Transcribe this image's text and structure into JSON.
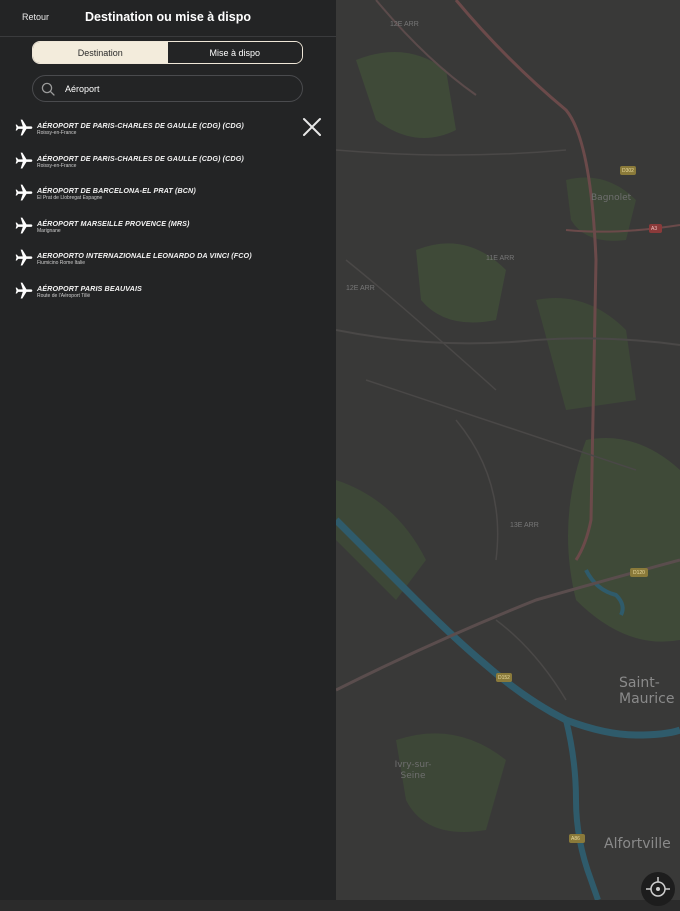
{
  "header": {
    "back_label": "Retour",
    "title": "Destination ou mise à dispo"
  },
  "segmented": {
    "tabs": [
      {
        "label": "Destination",
        "active": true
      },
      {
        "label": "Mise à dispo",
        "active": false
      }
    ]
  },
  "search": {
    "value": "Aéroport",
    "icon": "search-icon"
  },
  "results": [
    {
      "title": "AÉROPORT DE PARIS-CHARLES DE GAULLE (CDG) (CDG)",
      "subtitle": "Roissy-en-France",
      "icon": "airplane-icon"
    },
    {
      "title": "AÉROPORT DE PARIS-CHARLES DE GAULLE (CDG) (CDG)",
      "subtitle": "Roissy-en-France",
      "icon": "airplane-icon"
    },
    {
      "title": "AÉROPORT DE BARCELONA-EL PRAT (BCN)",
      "subtitle": "El Prat de Llobregat Espagne",
      "icon": "airplane-icon"
    },
    {
      "title": "AÉROPORT MARSEILLE PROVENCE (MRS)",
      "subtitle": "Marignane",
      "icon": "airplane-icon"
    },
    {
      "title": "AEROPORTO INTERNAZIONALE LEONARDO DA VINCI (FCO)",
      "subtitle": "Fiumicino Rome Italie",
      "icon": "airplane-icon"
    },
    {
      "title": "AÉROPORT PARIS BEAUVAIS",
      "subtitle": "Route de l'Aéroport Tillé",
      "icon": "airplane-icon"
    }
  ],
  "close_icon": "close-icon",
  "map": {
    "labels": [
      "12E ARR",
      "11E ARR",
      "12E ARR",
      "13E ARR"
    ],
    "places": [
      "Bagnolet",
      "Saint-Maurice",
      "Ivry-sur-Seine",
      "Alfortville"
    ],
    "road_badges": [
      "D302",
      "A3",
      "D120",
      "D152",
      "A86"
    ],
    "colors": {
      "park": "#3f4a38",
      "water": "#2f5b6b",
      "road_major": "#6b4a4a"
    }
  },
  "locate_icon": "locate-icon"
}
